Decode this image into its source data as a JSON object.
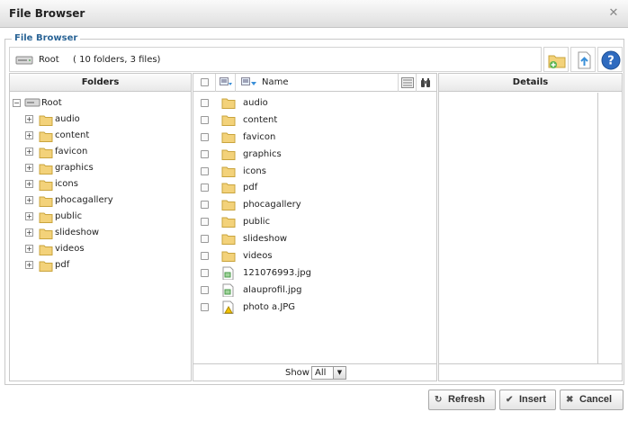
{
  "window": {
    "title": "File Browser"
  },
  "fieldset_legend": "File Browser",
  "path": {
    "name": "Root",
    "info": "( 10 folders, 3 files)"
  },
  "panels": {
    "folders_header": "Folders",
    "details_header": "Details"
  },
  "tree": {
    "root_label": "Root",
    "folders": [
      "audio",
      "content",
      "favicon",
      "graphics",
      "icons",
      "phocagallery",
      "public",
      "slideshow",
      "videos",
      "pdf"
    ]
  },
  "file_list": {
    "name_header": "Name",
    "items": [
      {
        "label": "audio",
        "type": "folder"
      },
      {
        "label": "content",
        "type": "folder"
      },
      {
        "label": "favicon",
        "type": "folder"
      },
      {
        "label": "graphics",
        "type": "folder"
      },
      {
        "label": "icons",
        "type": "folder"
      },
      {
        "label": "pdf",
        "type": "folder"
      },
      {
        "label": "phocagallery",
        "type": "folder"
      },
      {
        "label": "public",
        "type": "folder"
      },
      {
        "label": "slideshow",
        "type": "folder"
      },
      {
        "label": "videos",
        "type": "folder"
      },
      {
        "label": "121076993.jpg",
        "type": "image"
      },
      {
        "label": "alauprofil.jpg",
        "type": "image"
      },
      {
        "label": "photo a.JPG",
        "type": "warning-image"
      }
    ],
    "show_label": "Show",
    "show_value": "All"
  },
  "buttons": {
    "refresh": "Refresh",
    "insert": "Insert",
    "cancel": "Cancel"
  },
  "colors": {
    "legend": "#2a6496",
    "folder": "#f3d27a",
    "help": "#2f6bbf"
  }
}
